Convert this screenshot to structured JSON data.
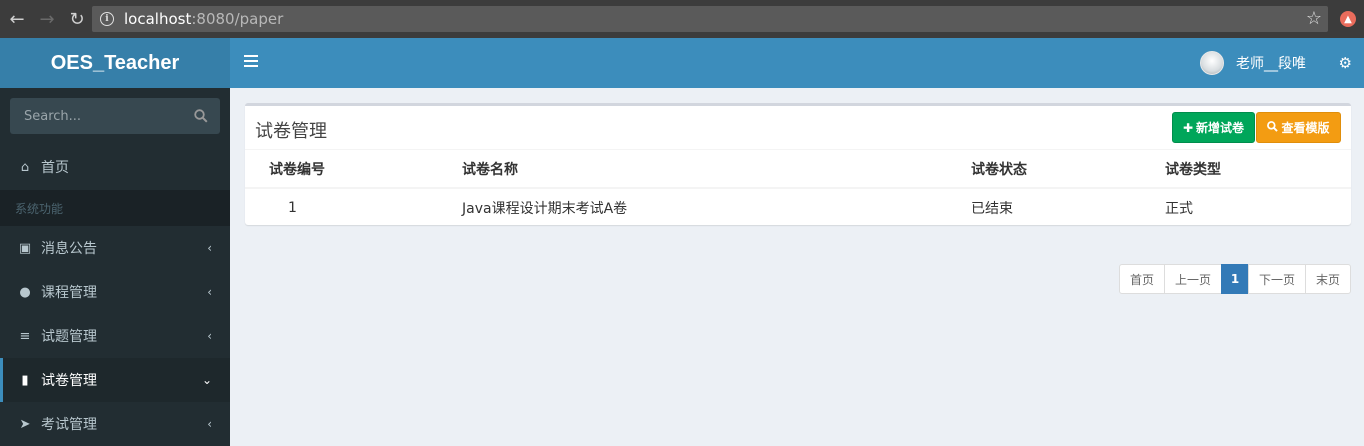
{
  "browser": {
    "url_host": "localhost",
    "url_path": ":8080/paper"
  },
  "header": {
    "logo": "OES_Teacher",
    "user_name": "老师__段唯"
  },
  "sidebar": {
    "search_placeholder": "Search...",
    "home": "首页",
    "section_header": "系统功能",
    "items": [
      {
        "label": "消息公告",
        "icon": "id-card-icon"
      },
      {
        "label": "课程管理",
        "icon": "users-icon"
      },
      {
        "label": "试题管理",
        "icon": "list-icon"
      },
      {
        "label": "试卷管理",
        "icon": "book-icon",
        "active": true
      },
      {
        "label": "考试管理",
        "icon": "paper-plane-icon"
      }
    ]
  },
  "box": {
    "title": "试卷管理",
    "add_button": "新增试卷",
    "view_button": "查看模版"
  },
  "table": {
    "columns": [
      "试卷编号",
      "试卷名称",
      "试卷状态",
      "试卷类型"
    ],
    "rows": [
      [
        "1",
        "Java课程设计期末考试A卷",
        "已结束",
        "正式"
      ]
    ]
  },
  "pagination": {
    "first": "首页",
    "prev": "上一页",
    "current": "1",
    "next": "下一页",
    "last": "末页"
  },
  "colors": {
    "header": "#3c8dbc",
    "logo": "#367fa9",
    "sidebar": "#222d32",
    "success": "#00a65a",
    "warning": "#f39c12",
    "page_active": "#337ab7"
  }
}
